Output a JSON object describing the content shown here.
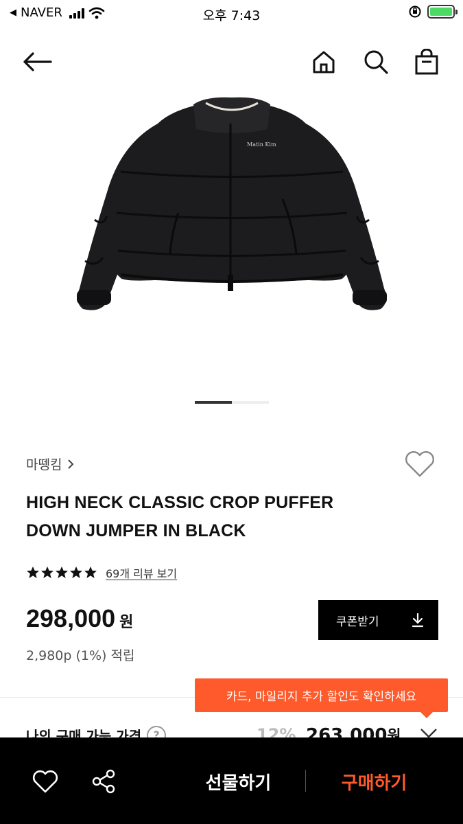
{
  "status_bar": {
    "carrier": "NAVER",
    "time": "오후 7:43",
    "battery_color": "#4cd964"
  },
  "nav": {
    "back_icon": "arrow-left-icon",
    "home_icon": "home-icon",
    "search_icon": "search-icon",
    "bag_icon": "shopping-bag-icon"
  },
  "carousel": {
    "current": 1,
    "total": 2
  },
  "product": {
    "brand": "마뗑킴",
    "title_line1": "HIGH NECK CLASSIC CROP PUFFER",
    "title_line2": "DOWN JUMPER IN BLACK",
    "rating_stars": 5,
    "review_link": "69개 리뷰 보기",
    "price": "298,000",
    "price_unit": "원",
    "points": "2,980p (1%) 적립",
    "jacket_logo": "Matin Kim"
  },
  "coupon": {
    "label": "쿠폰받기"
  },
  "tooltip": {
    "text": "카드, 마일리지 추가 할인도 확인하세요"
  },
  "my_price": {
    "label": "나의 구매 가능 가격",
    "discount_rate": "12%",
    "price": "263,000",
    "unit": "원"
  },
  "bottom_bar": {
    "gift_label": "선물하기",
    "buy_label": "구매하기",
    "buy_color": "#ff5a2b"
  }
}
